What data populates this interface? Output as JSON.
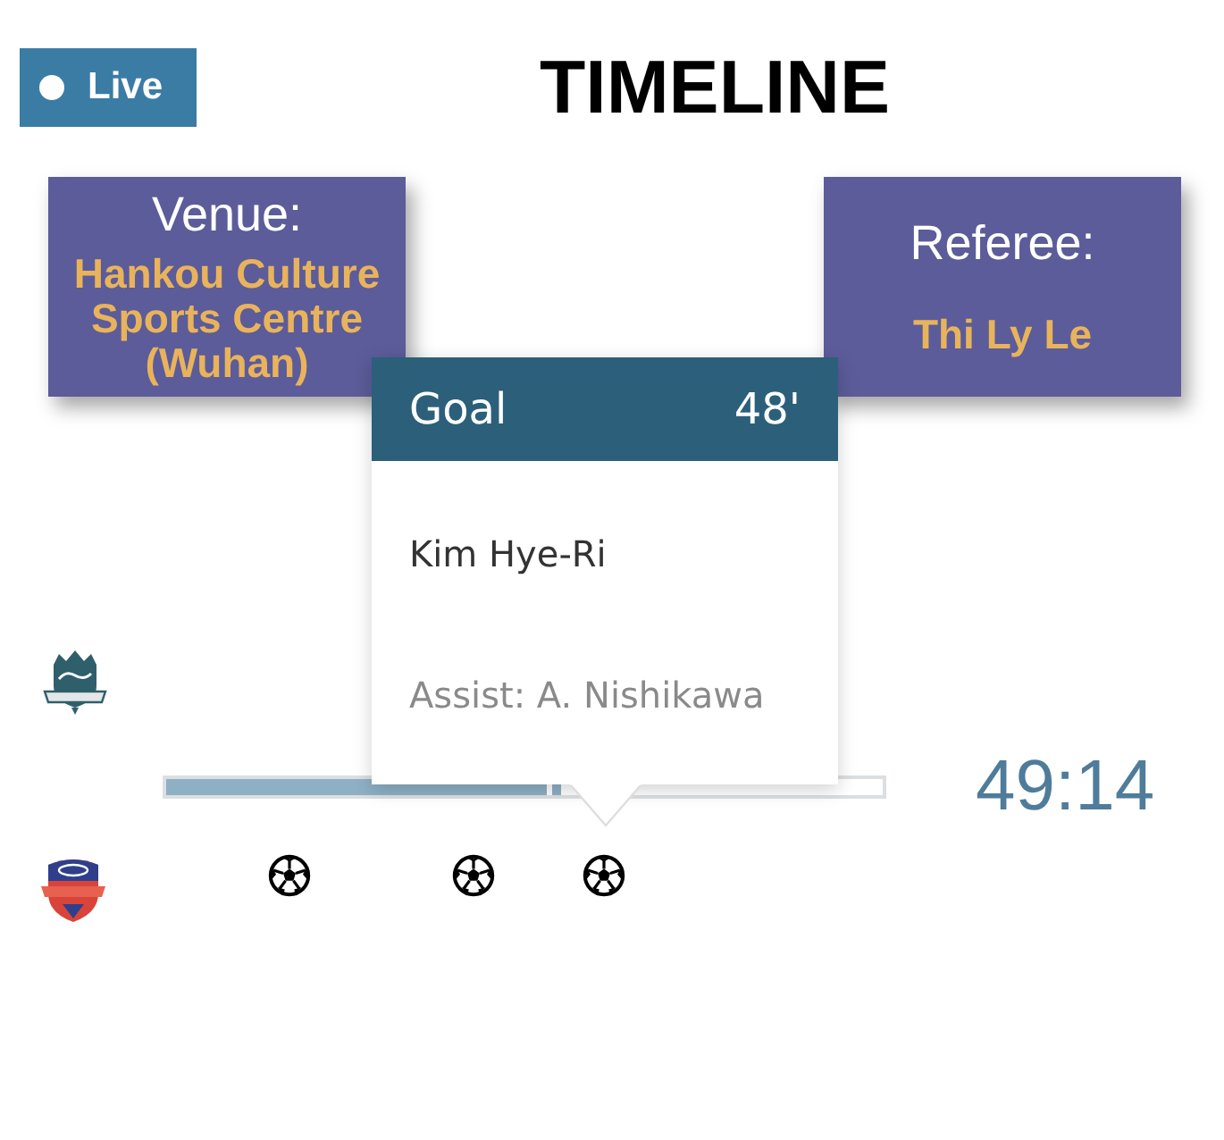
{
  "live_badge": {
    "label": "Live"
  },
  "title": "TIMELINE",
  "info_cards": [
    {
      "label": "Venue:",
      "value": "Hankou Culture Sports Centre (Wuhan)"
    },
    {
      "label": "Referee:",
      "value": "Thi Ly Le"
    }
  ],
  "teams": [
    {
      "kind": "home"
    },
    {
      "kind": "away",
      "events": [
        {
          "kind": "goal"
        },
        {
          "kind": "goal"
        },
        {
          "kind": "goal",
          "popup": {
            "title": "Goal",
            "minute": "48'",
            "player": "Kim Hye-Ri",
            "assist": "Assist: A. Nishikawa"
          }
        }
      ]
    }
  ],
  "progress": {
    "level": 0.55
  },
  "clock": "49:14"
}
